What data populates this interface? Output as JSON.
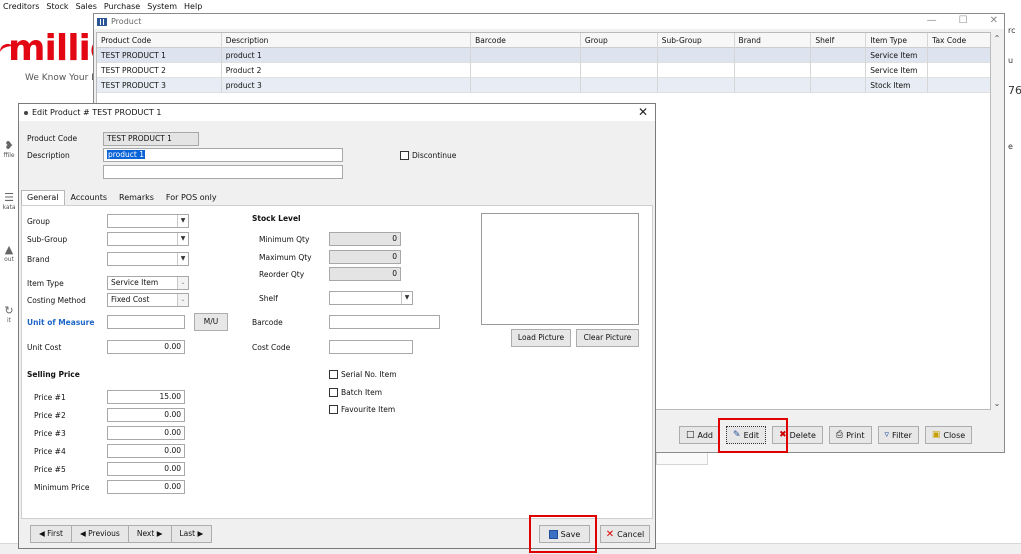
{
  "menubar": [
    "Creditors",
    "Stock",
    "Sales",
    "Purchase",
    "System",
    "Help"
  ],
  "logo": {
    "text": "millic",
    "tagline": "We Know Your I"
  },
  "side_icons": [
    "ffile",
    "kata",
    "out",
    "it"
  ],
  "right_clip": [
    "rc",
    "u",
    "76",
    "e"
  ],
  "product_window": {
    "title": "Product",
    "columns": [
      "Product Code",
      "Description",
      "Barcode",
      "Group",
      "Sub-Group",
      "Brand",
      "Shelf",
      "Item Type",
      "Tax Code"
    ],
    "rows": [
      [
        "TEST PRODUCT 1",
        "product 1",
        "",
        "",
        "",
        "",
        "",
        "Service Item",
        ""
      ],
      [
        "TEST PRODUCT 2",
        "Product 2",
        "",
        "",
        "",
        "",
        "",
        "Service Item",
        ""
      ],
      [
        "TEST PRODUCT 3",
        "product 3",
        "",
        "",
        "",
        "",
        "",
        "Stock Item",
        ""
      ]
    ],
    "buttons": {
      "add": "Add",
      "edit": "Edit",
      "delete": "Delete",
      "print": "Print",
      "filter": "Filter",
      "close": "Close"
    }
  },
  "edit_dialog": {
    "title": "Edit Product # TEST PRODUCT 1",
    "product_code_label": "Product Code",
    "product_code": "TEST PRODUCT 1",
    "description_label": "Description",
    "description": "product 1",
    "description2": "",
    "discontinue_label": "Discontinue",
    "tabs": [
      "General",
      "Accounts",
      "Remarks",
      "For POS only"
    ],
    "active_tab": "General",
    "general": {
      "group_label": "Group",
      "subgroup_label": "Sub-Group",
      "brand_label": "Brand",
      "item_type_label": "Item Type",
      "item_type": "Service Item",
      "costing_method_label": "Costing Method",
      "costing_method": "Fixed Cost",
      "uom_label": "Unit of Measure",
      "mu_button": "M/U",
      "unit_cost_label": "Unit Cost",
      "unit_cost": "0.00",
      "selling_price_label": "Selling Price",
      "prices": [
        {
          "label": "Price #1",
          "value": "15.00"
        },
        {
          "label": "Price #2",
          "value": "0.00"
        },
        {
          "label": "Price #3",
          "value": "0.00"
        },
        {
          "label": "Price #4",
          "value": "0.00"
        },
        {
          "label": "Price #5",
          "value": "0.00"
        },
        {
          "label": "Minimum Price",
          "value": "0.00"
        }
      ],
      "stock_level_label": "Stock Level",
      "min_qty_label": "Minimum Qty",
      "min_qty": "0",
      "max_qty_label": "Maximum Qty",
      "max_qty": "0",
      "reorder_qty_label": "Reorder Qty",
      "reorder_qty": "0",
      "shelf_label": "Shelf",
      "barcode_label": "Barcode",
      "cost_code_label": "Cost Code",
      "serial_label": "Serial No. Item",
      "batch_label": "Batch Item",
      "favourite_label": "Favourite Item",
      "load_picture": "Load Picture",
      "clear_picture": "Clear Picture"
    },
    "nav": {
      "first": "First",
      "previous": "Previous",
      "next": "Next",
      "last": "Last"
    },
    "save": "Save",
    "cancel": "Cancel"
  },
  "colors": {
    "highlight": "#e00000",
    "selection": "#0a64d8",
    "logo_red": "#e30613"
  }
}
